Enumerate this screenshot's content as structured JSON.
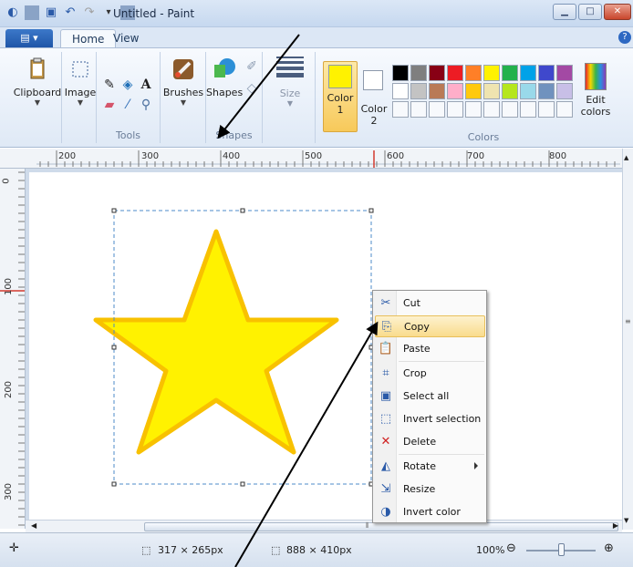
{
  "window": {
    "title": "Untitled - Paint",
    "controls": {
      "minimize_icon": "minimize-icon",
      "maximize_icon": "maximize-icon",
      "close_icon": "close-icon"
    }
  },
  "tabs": [
    "Home",
    "View"
  ],
  "ribbon": {
    "clipboard": {
      "label": "Clipboard"
    },
    "image": {
      "label": "Image"
    },
    "tools": {
      "group_label": "Tools"
    },
    "brushes": {
      "label": "Brushes"
    },
    "shapes": {
      "label": "Shapes",
      "group_label": "Shapes"
    },
    "size": {
      "label": "Size"
    },
    "color1": {
      "line1": "Color",
      "line2": "1",
      "value": "#FFF200"
    },
    "color2": {
      "line1": "Color",
      "line2": "2",
      "value": "#FFFFFF"
    },
    "colors_group_label": "Colors",
    "edit_colors": {
      "line1": "Edit",
      "line2": "colors"
    },
    "palette": [
      "#000000",
      "#7F7F7F",
      "#880015",
      "#ED1C24",
      "#FF7F27",
      "#FFF200",
      "#22B14C",
      "#00A2E8",
      "#3F48CC",
      "#A349A4",
      "#FFFFFF",
      "#C3C3C3",
      "#B97A57",
      "#FFAEC9",
      "#FFC90E",
      "#EFE4B0",
      "#B5E61D",
      "#99D9EA",
      "#7092BE",
      "#C8BFE7",
      "",
      "",
      "",
      "",
      "",
      "",
      "",
      "",
      "",
      ""
    ]
  },
  "ruler": {
    "h_labels": [
      "200",
      "300",
      "400",
      "500",
      "600",
      "700",
      "800"
    ],
    "v_labels": [
      "0",
      "100",
      "200",
      "300"
    ]
  },
  "canvas": {
    "shape": "star",
    "fill_color": "#FFF200",
    "outline_color": "#F8C100"
  },
  "context_menu": {
    "items": [
      {
        "label": "Cut",
        "icon": "cut-icon"
      },
      {
        "label": "Copy",
        "icon": "copy-icon",
        "highlighted": true
      },
      {
        "label": "Paste",
        "icon": "paste-icon"
      },
      {
        "label": "Crop",
        "icon": "crop-icon"
      },
      {
        "label": "Select all",
        "icon": "select-all-icon"
      },
      {
        "label": "Invert selection",
        "icon": "invert-selection-icon"
      },
      {
        "label": "Delete",
        "icon": "delete-icon"
      },
      {
        "label": "Rotate",
        "icon": "rotate-icon",
        "submenu": true
      },
      {
        "label": "Resize",
        "icon": "resize-icon"
      },
      {
        "label": "Invert color",
        "icon": "invert-color-icon"
      }
    ]
  },
  "status": {
    "selection_size": "317 × 265px",
    "canvas_size": "888 × 410px",
    "zoom": "100%"
  }
}
